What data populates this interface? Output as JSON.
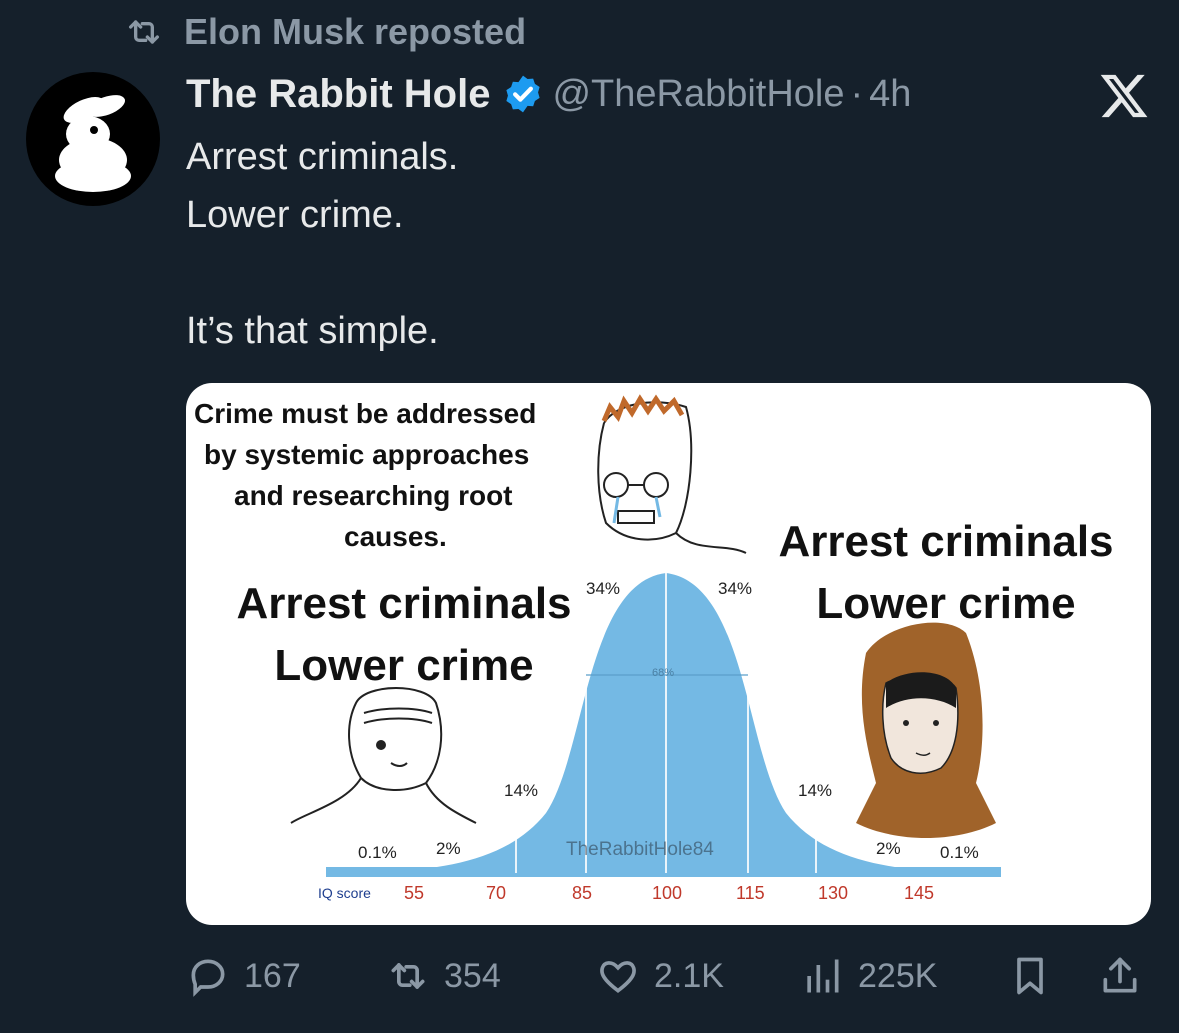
{
  "repost": {
    "text": "Elon Musk reposted",
    "icon": "repost-icon"
  },
  "author": {
    "display_name": "The Rabbit Hole",
    "handle": "@TheRabbitHole",
    "separator": "·",
    "time": "4h",
    "verified": true,
    "verified_color": "#1d9bf0"
  },
  "tweet": {
    "lines": [
      "Arrest criminals.",
      "Lower crime.",
      "",
      "It’s that simple."
    ]
  },
  "meme": {
    "top_text": [
      "Crime must be addressed",
      "by systemic approaches",
      "and researching root",
      "causes."
    ],
    "left_text": [
      "Arrest criminals",
      "Lower crime"
    ],
    "right_text": [
      "Arrest criminals",
      "Lower crime"
    ],
    "percents": {
      "p1": "0.1%",
      "p2": "2%",
      "p3": "14%",
      "p4": "34%",
      "p5": "34%",
      "p6": "14%",
      "p7": "2%",
      "p8": "0.1%",
      "center": "68%"
    },
    "iq_label": "IQ score",
    "iq_ticks": [
      "55",
      "70",
      "85",
      "100",
      "115",
      "130",
      "145"
    ],
    "watermark": "TheRabbitHole84"
  },
  "actions": {
    "replies": "167",
    "reposts": "354",
    "likes": "2.1K",
    "views": "225K"
  },
  "colors": {
    "background": "#15202b",
    "muted": "#8b98a5",
    "curve": "#74b9e4"
  }
}
